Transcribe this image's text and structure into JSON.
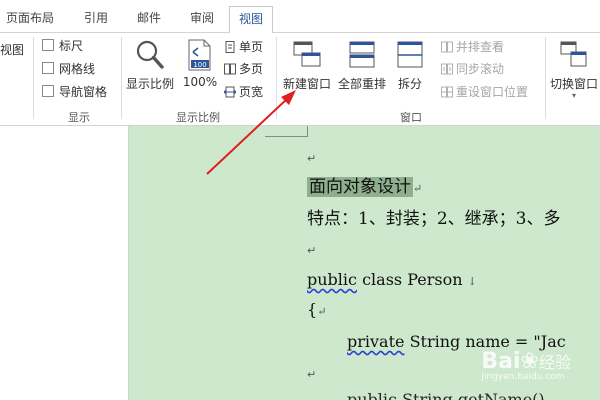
{
  "tabs": {
    "page_layout": "页面布局",
    "references": "引用",
    "mailings": "邮件",
    "review": "审阅",
    "view": "视图"
  },
  "ribbon": {
    "left_partial_label": "视图",
    "show_group": {
      "label": "显示",
      "ruler": "标尺",
      "gridlines": "网格线",
      "nav_pane": "导航窗格"
    },
    "zoom_group": {
      "label": "显示比例",
      "zoom": "显示比例",
      "percent": "100%",
      "one_page": "单页",
      "multi_page": "多页",
      "page_width": "页宽"
    },
    "window_group": {
      "label": "窗口",
      "new_window": "新建窗口",
      "arrange_all": "全部重排",
      "split": "拆分",
      "side_by_side": "并排查看",
      "sync_scroll": "同步滚动",
      "reset_window": "重设窗口位置",
      "switch_window": "切换窗口"
    }
  },
  "document": {
    "title": "面向对象设计",
    "features": "特点：1、封装；2、继承；3、多",
    "kw_public": "public",
    "class_decl": " class Person ",
    "brace": "{",
    "kw_private": "private",
    "field_decl": " String name = \"Jac",
    "partial_line": "public String getName()",
    "para_mark": "↵",
    "down_arrow": "↓"
  },
  "watermark": {
    "brand": "Bai",
    "brand_suffix": "经验",
    "url": "jingyan.baidu.com"
  },
  "colors": {
    "accent": "#2b579a",
    "doc_bg": "#cde8cd",
    "arrow": "#e02020"
  }
}
